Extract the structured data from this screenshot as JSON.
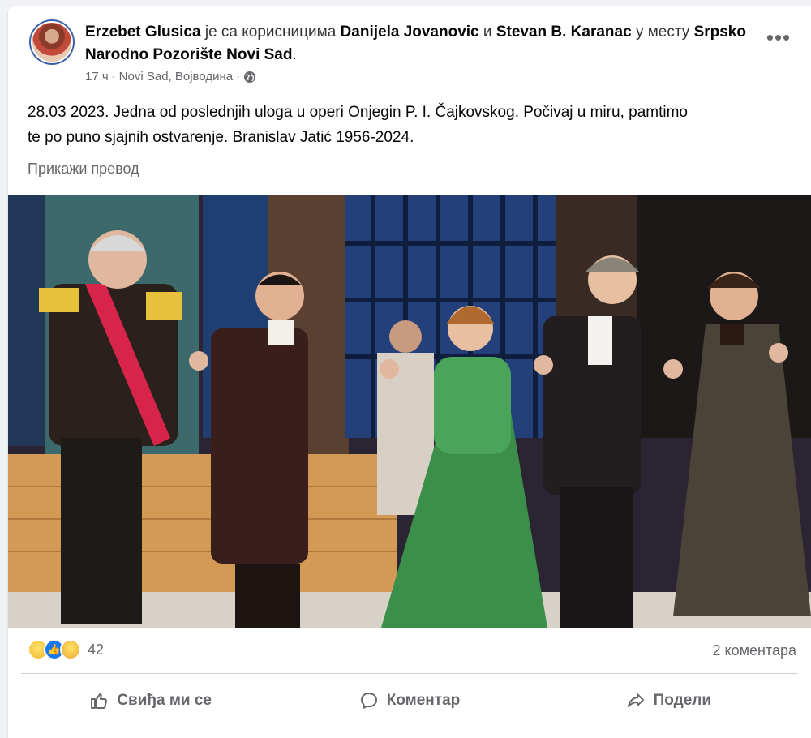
{
  "post": {
    "author": "Erzebet Glusica",
    "with_text": "је са корисницима",
    "tag1": "Danijela Jovanovic",
    "and_text": "и",
    "tag2": "Stevan B. Karanac",
    "place_text": "у месту",
    "place": "Srpsko Narodno Pozorište Novi Sad",
    "time": "17 ч",
    "location": "Novi Sad, Војводина",
    "sep": "·",
    "text_line1": "28.03 2023. Jedna od poslednjih uloga u operi Onjegin P. I. Čajkovskog. Počivaj u miru, pamtimo",
    "text_line2": "te po puno sjajnih ostvarenje. Branislav Jatić 1956-2024.",
    "translate": "Прикажи превод",
    "more_icon": "more-dots-icon"
  },
  "stats": {
    "reaction_count": "42",
    "comments": "2 коментара",
    "reaction_icons": [
      "sad-icon",
      "like-icon",
      "care-icon"
    ]
  },
  "actions": {
    "like": "Свиђа ми се",
    "comment": "Коментар",
    "share": "Подели"
  },
  "colors": {
    "accent": "#1877f2",
    "muted": "#65676b",
    "background": "#f0f2f5"
  }
}
